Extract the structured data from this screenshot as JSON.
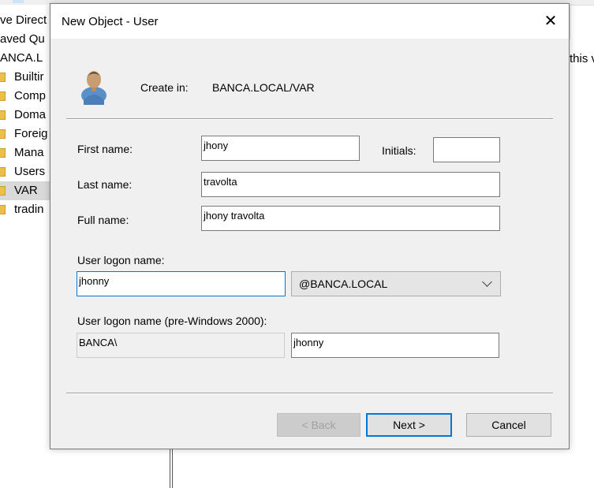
{
  "background": {
    "tree_items": [
      {
        "label": "ve Direct",
        "icon": false,
        "selected": false
      },
      {
        "label": "aved Qu",
        "icon": false,
        "selected": false
      },
      {
        "label": "ANCA.L",
        "icon": false,
        "selected": false
      },
      {
        "label": "Builtir",
        "icon": true,
        "selected": false
      },
      {
        "label": "Comp",
        "icon": true,
        "selected": false
      },
      {
        "label": "Doma",
        "icon": true,
        "selected": false
      },
      {
        "label": "Foreig",
        "icon": true,
        "selected": false
      },
      {
        "label": "Mana",
        "icon": true,
        "selected": false
      },
      {
        "label": "Users",
        "icon": true,
        "selected": false
      },
      {
        "label": "VAR",
        "icon": true,
        "selected": true
      },
      {
        "label": "tradin",
        "icon": true,
        "selected": false
      }
    ],
    "right_text": "this v"
  },
  "dialog": {
    "title": "New Object - User",
    "close_glyph": "✕",
    "create_in_label": "Create in:",
    "create_in_value": "BANCA.LOCAL/VAR",
    "first_name_label": "First name:",
    "first_name_value": "jhony",
    "initials_label": "Initials:",
    "initials_value": "",
    "last_name_label": "Last name:",
    "last_name_value": "travolta",
    "full_name_label": "Full name:",
    "full_name_value": "jhony travolta",
    "logon_name_label": "User logon name:",
    "logon_name_value": "jhonny",
    "domain_value": "@BANCA.LOCAL",
    "pre2000_label": "User logon name (pre-Windows 2000):",
    "pre2000_domain_value": "BANCA\\",
    "pre2000_name_value": "jhonny",
    "back_label": "< Back",
    "next_label": "Next >",
    "cancel_label": "Cancel"
  },
  "colors": {
    "accent": "#0078d7",
    "dialog_bg": "#f0f0f0",
    "folder": "#e8c04a"
  }
}
